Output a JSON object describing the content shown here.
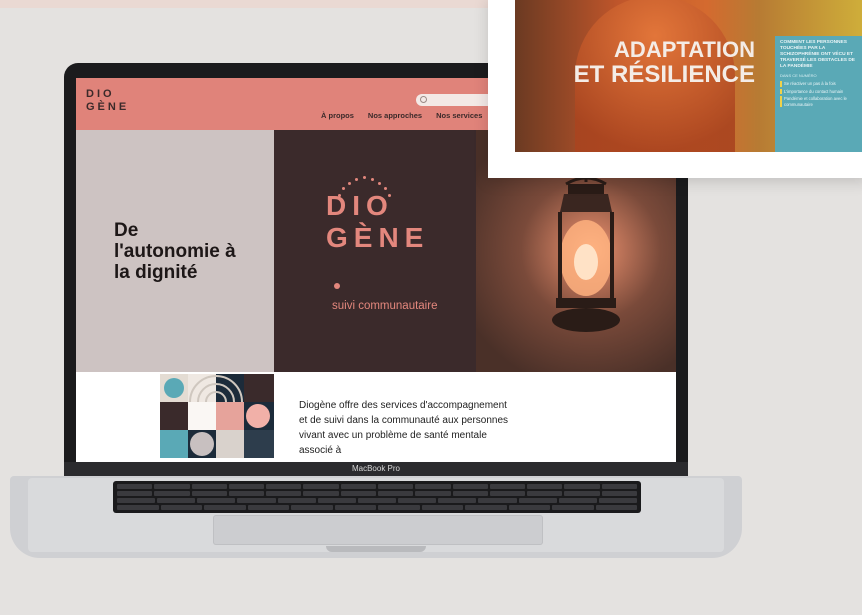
{
  "laptop": {
    "model_label": "MacBook Pro"
  },
  "site": {
    "logo": {
      "line1": "DIO",
      "line2": "GÈNE"
    },
    "nav": [
      "À propos",
      "Nos approches",
      "Nos services"
    ],
    "hero": {
      "title": "De l'autonomie à la dignité",
      "brand_line1": "DIO",
      "brand_line2": "GÈNE",
      "tagline": "suivi communautaire"
    },
    "description": "Diogène offre des services d'accompagnement et de suivi dans la communauté aux personnes vivant avec un problème de santé mentale associé à"
  },
  "magazine": {
    "title_line1": "ADAPTATION",
    "title_line2": "ET RÉSILIENCE",
    "panel_heading": "COMMENT LES PERSONNES TOUCHÉES PAR LA SCHIZOPHRÉNIE ONT VÉCU ET TRAVERSÉ LES OBSTACLES DE LA PANDÉMIE",
    "panel_sub": "DANS CE NUMÉRO",
    "panel_items": [
      "Se réactiver un pas à la fois",
      "L'importance du contact humain",
      "Pandémie et collaboration avec le communautaire"
    ]
  },
  "colors": {
    "header_salmon": "#e0837a",
    "brand_coral": "#e3877d",
    "hero_dark": "#3b2a2b",
    "hero_grey": "#cdc3c2",
    "panel_teal": "#5aa9b6"
  }
}
